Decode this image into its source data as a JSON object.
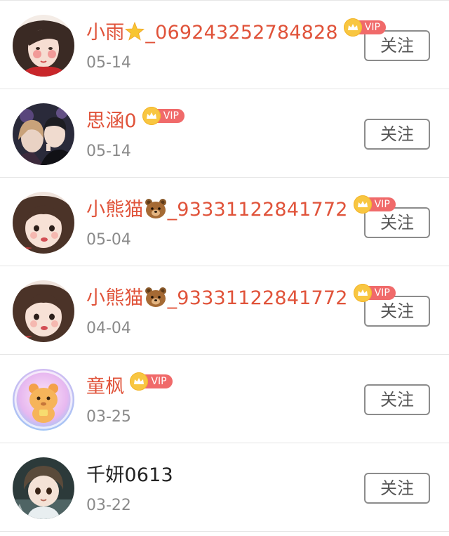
{
  "follow_label": "关注",
  "vip_label": "VIP",
  "colors": {
    "vip_name": "#e0533a",
    "plain_name": "#222222",
    "date": "#8a8a8a",
    "vip_tag": "#f06a6a",
    "crown": "#f8c641",
    "divider": "#e6e6e6"
  },
  "users": [
    {
      "name_prefix": "小雨",
      "emoji": "star-emoji",
      "name_suffix": "_069243252784828",
      "vip": true,
      "date": "05-14"
    },
    {
      "name_prefix": "思涵0",
      "emoji": "",
      "name_suffix": "",
      "vip": true,
      "date": "05-14"
    },
    {
      "name_prefix": "小熊猫",
      "emoji": "bear-emoji",
      "name_suffix": "_93331122841772",
      "vip": true,
      "date": "05-04"
    },
    {
      "name_prefix": "小熊猫",
      "emoji": "bear-emoji",
      "name_suffix": "_93331122841772",
      "vip": true,
      "date": "04-04"
    },
    {
      "name_prefix": "童枫",
      "emoji": "",
      "name_suffix": "",
      "vip": true,
      "date": "03-25"
    },
    {
      "name_prefix": "千妍0613",
      "emoji": "",
      "name_suffix": "",
      "vip": false,
      "date": "03-22"
    }
  ]
}
